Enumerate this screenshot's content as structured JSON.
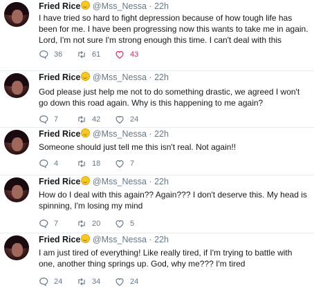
{
  "tweets": [
    {
      "name": "Fried Rice",
      "handle": "@Mss_Nessa",
      "time": "22h",
      "text": "I have tried so hard to fight depression because of how tough life has been for me. I have been progressing now this wants to take me in again. Lord, I'm not sure I'm strong enough this time. I can't deal with this",
      "replies": "36",
      "retweets": "61",
      "likes": "43",
      "liked": true
    },
    {
      "name": "Fried Rice",
      "handle": "@Mss_Nessa",
      "time": "22h",
      "text": "God please just help me not to do something drastic, we agreed I won't go down this road again. Why is this happening to me again?",
      "replies": "7",
      "retweets": "42",
      "likes": "24",
      "liked": false
    },
    {
      "name": "Fried Rice",
      "handle": "@Mss_Nessa",
      "time": "22h",
      "text": "Someone should just tell me this  isn't real. Not again!!",
      "replies": "4",
      "retweets": "18",
      "likes": "7",
      "liked": false
    },
    {
      "name": "Fried Rice",
      "handle": "@Mss_Nessa",
      "time": "22h",
      "text": "How do I deal with this again?? Again??? I don't deserve this. My head is spinning, I'm losing my mind",
      "replies": "7",
      "retweets": "20",
      "likes": "5",
      "liked": false
    },
    {
      "name": "Fried Rice",
      "handle": "@Mss_Nessa",
      "time": "22h",
      "text": "I am just tired of everything! Like really tired, if I'm trying to battle with one, another thing springs up. God, why me??? I'm tired",
      "replies": "24",
      "retweets": "34",
      "likes": "24",
      "liked": false
    }
  ],
  "icons": {
    "reply": "reply-icon",
    "retweet": "retweet-icon",
    "like": "heart-icon",
    "emoji": "grinning-face-icon"
  },
  "colors": {
    "text": "#14171a",
    "muted": "#657786",
    "like_active": "#e0245e",
    "divider": "#e6ecf0"
  }
}
